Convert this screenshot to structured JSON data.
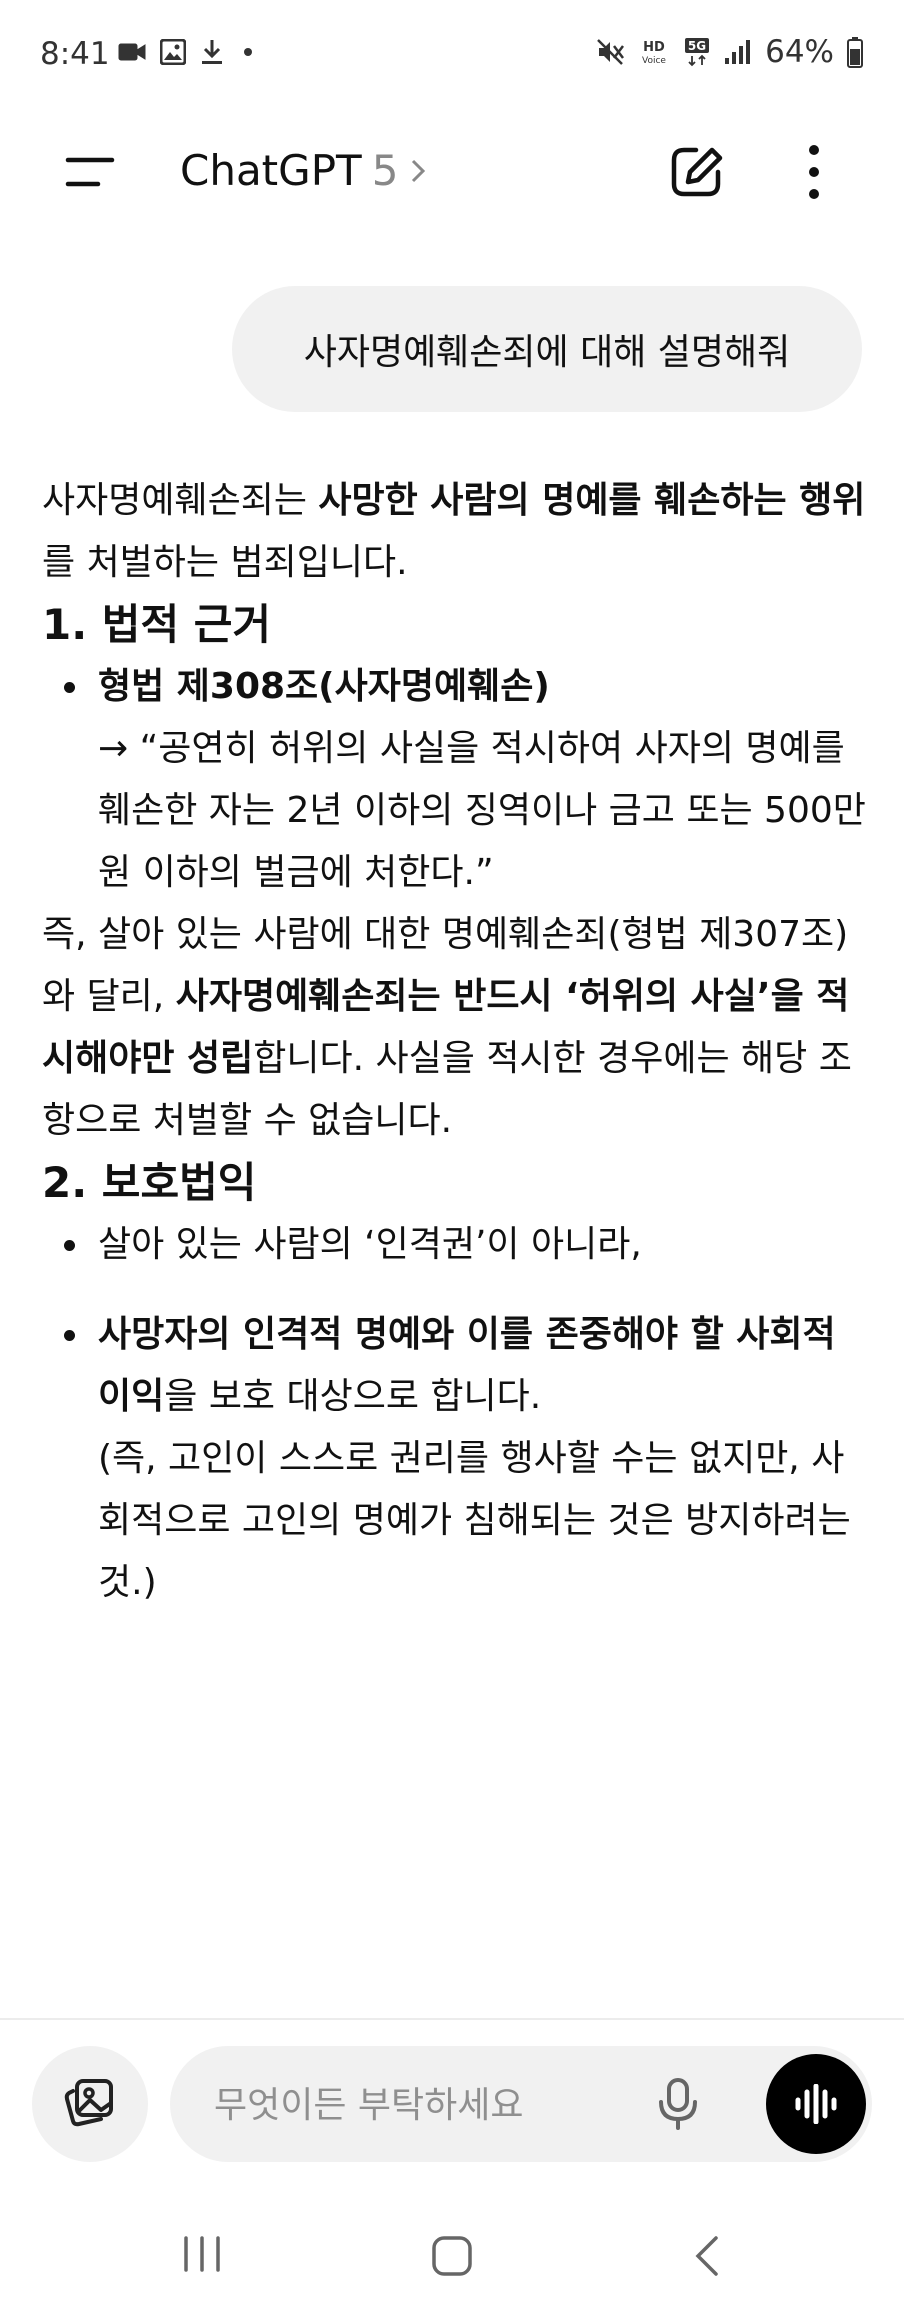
{
  "status": {
    "time": "8:41",
    "battery": "64%",
    "hd_label": "HD",
    "voice_label": "Voice",
    "net_label": "5G"
  },
  "header": {
    "title": "ChatGPT",
    "version": "5"
  },
  "user_message": "사자명예훼손죄에 대해 설명해줘",
  "assistant": {
    "intro": {
      "t1": "사자명예훼손죄는 ",
      "b1": "사망한 사람의 명예를 훼손하는 행위",
      "t2": "를 처벌하는 범죄입니다."
    },
    "heading1": "1. 법적 근거",
    "law_title": "형법 제308조(사자명예훼손)",
    "law_quote": "→ “공연히 허위의 사실을 적시하여 사자의 명예를 훼손한 자는 2년 이하의 징역이나 금고 또는 500만 원 이하의 벌금에 처한다.”",
    "p2": {
      "t1": "즉, 살아 있는 사람에 대한 명예훼손죄(형법 제307조)와 달리, ",
      "b1": "사자명예훼손죄는 반드시 ‘허위의 사실’을 적시해야만 성립",
      "t2": "합니다. 사실을 적시한 경우에는 해당 조항으로 처벌할 수 없습니다."
    },
    "heading2": "2. 보호법익",
    "bullet1": "살아 있는 사람의 ‘인격권’이 아니라,",
    "bullet2": {
      "b1": "사망자의 인격적 명예와 이를 존중해야 할 사회적 이익",
      "t1": "을 보호 대상으로 합니다.",
      "t2": "(즉, 고인이 스스로 권리를 행사할 수는 없지만, 사회적으로 고인의 명예가 침해되는 것은 방지하려는 것.)"
    }
  },
  "composer": {
    "placeholder": "무엇이든 부탁하세요"
  },
  "icons": {
    "menu": "menu-icon",
    "new_chat": "edit-icon",
    "more": "more-vertical-icon",
    "attach": "images-icon",
    "mic": "mic-icon",
    "voice": "voice-waveform-icon",
    "nav_recents": "recents-icon",
    "nav_home": "home-icon",
    "nav_back": "back-icon"
  }
}
